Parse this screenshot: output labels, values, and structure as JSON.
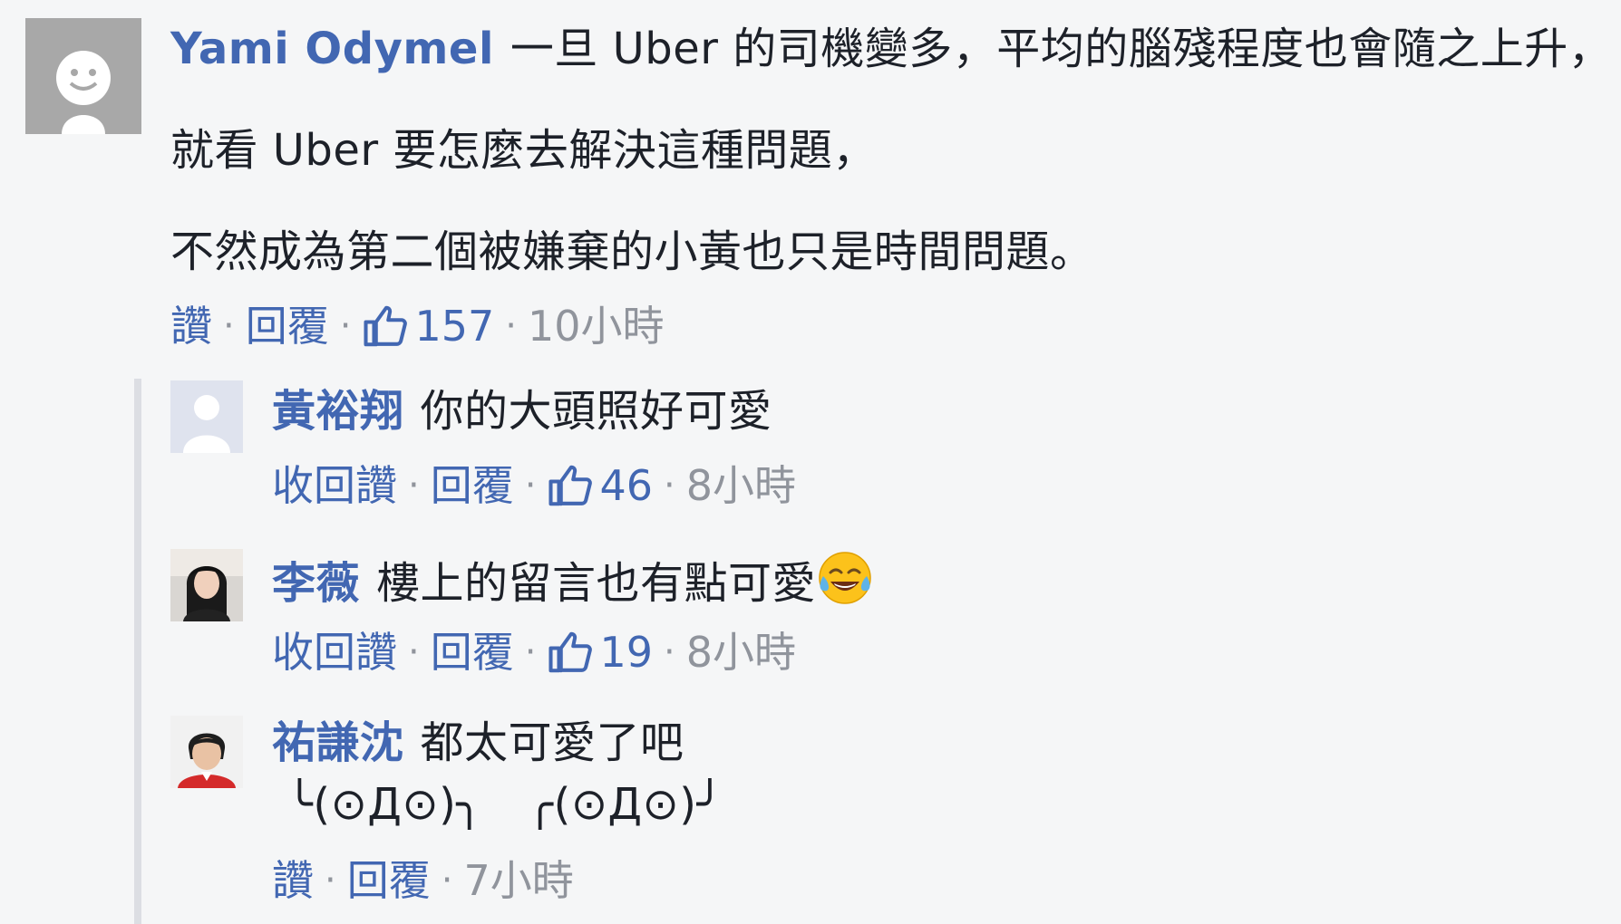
{
  "comments": [
    {
      "author": "Yami Odymel",
      "lines": [
        "一旦 Uber 的司機變多，平均的腦殘程度也會隨之上升，",
        "就看 Uber 要怎麼去解決這種問題，",
        "不然成為第二個被嫌棄的小黃也只是時間問題。"
      ],
      "like_label": "讚",
      "reply_label": "回覆",
      "like_count": "157",
      "time": "10小時",
      "avatar": "default-avatar-icon"
    }
  ],
  "replies": [
    {
      "author": "黃裕翔",
      "lines": [
        "你的大頭照好可愛"
      ],
      "like_label": "收回讚",
      "reply_label": "回覆",
      "like_count": "46",
      "time": "8小時",
      "avatar": "silhouette-avatar-icon"
    },
    {
      "author": "李薇",
      "lines": [
        "樓上的留言也有點可愛"
      ],
      "emoji": "tears-of-joy-emoji-icon",
      "like_label": "收回讚",
      "reply_label": "回覆",
      "like_count": "19",
      "time": "8小時",
      "avatar": "profile-photo-icon"
    },
    {
      "author": "祐謙沈",
      "lines": [
        "都太可愛了吧",
        "╰(⊙Д⊙)╮　╭(⊙Д⊙)╯"
      ],
      "like_label": "讚",
      "reply_label": "回覆",
      "time": "7小時",
      "avatar": "profile-photo-icon"
    }
  ],
  "colors": {
    "background": "#f5f6f7",
    "author": "#365899",
    "link": "#4267b2",
    "meta": "#90949c",
    "text": "#1d2129"
  },
  "separator": "·"
}
